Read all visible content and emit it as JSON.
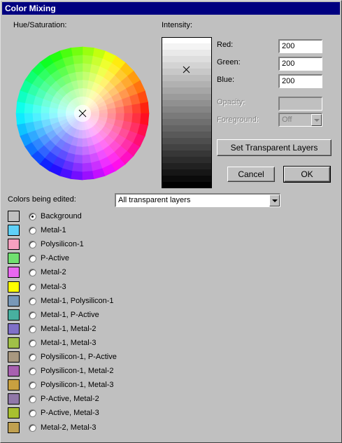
{
  "window": {
    "title": "Color Mixing"
  },
  "labels": {
    "hue_saturation": "Hue/Saturation:",
    "intensity": "Intensity:",
    "red": "Red:",
    "green": "Green:",
    "blue": "Blue:",
    "opacity": "Opacity:",
    "foreground": "Foreground:",
    "colors_being_edited": "Colors being edited:"
  },
  "fields": {
    "red": "200",
    "green": "200",
    "blue": "200",
    "opacity": "",
    "foreground": "Off"
  },
  "buttons": {
    "set_transparent": "Set Transparent Layers",
    "cancel": "Cancel",
    "ok": "OK"
  },
  "layer_select": {
    "value": "All transparent layers"
  },
  "colors": {
    "selected_index": 0,
    "items": [
      {
        "label": "Background",
        "color": "#c0c0c0"
      },
      {
        "label": "Metal-1",
        "color": "#5fd0f8"
      },
      {
        "label": "Polysilicon-1",
        "color": "#f8a0c0"
      },
      {
        "label": "P-Active",
        "color": "#70e070"
      },
      {
        "label": "Metal-2",
        "color": "#e868f0"
      },
      {
        "label": "Metal-3",
        "color": "#ffff00"
      },
      {
        "label": "Metal-1, Polysilicon-1",
        "color": "#7898b8"
      },
      {
        "label": "Metal-1, P-Active",
        "color": "#48b0a0"
      },
      {
        "label": "Metal-1, Metal-2",
        "color": "#8070c8"
      },
      {
        "label": "Metal-1, Metal-3",
        "color": "#a0c048"
      },
      {
        "label": "Polysilicon-1, P-Active",
        "color": "#a89880"
      },
      {
        "label": "Polysilicon-1, Metal-2",
        "color": "#a860b0"
      },
      {
        "label": "Polysilicon-1, Metal-3",
        "color": "#c8a040"
      },
      {
        "label": "P-Active, Metal-2",
        "color": "#9078a8"
      },
      {
        "label": "P-Active, Metal-3",
        "color": "#a8c030"
      },
      {
        "label": "Metal-2, Metal-3",
        "color": "#c0a050"
      }
    ]
  }
}
